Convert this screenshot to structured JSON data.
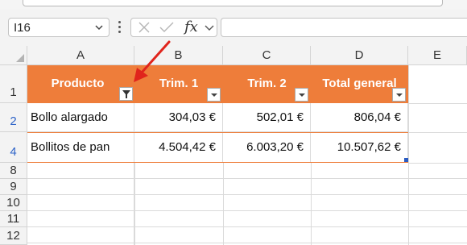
{
  "formula_bar": {
    "name_box": "I16",
    "fx": "fx"
  },
  "columns": [
    "A",
    "B",
    "C",
    "D",
    "E"
  ],
  "rows": [
    "1",
    "2",
    "4",
    "8",
    "9",
    "10",
    "11",
    "12"
  ],
  "table": {
    "headers": [
      "Producto",
      "Trim. 1",
      "Trim. 2",
      "Total general"
    ],
    "data": [
      [
        "Bollo alargado",
        "304,03 €",
        "502,01 €",
        "806,04 €"
      ],
      [
        "Bollitos de pan",
        "4.504,42 €",
        "6.003,20 €",
        "10.507,62 €"
      ]
    ]
  },
  "colors": {
    "header_fill": "#ee7d3a",
    "arrow": "#e0241c",
    "filtered_row_number": "#2f64c8"
  },
  "icons": {
    "cancel": "x-icon",
    "enter": "check-icon",
    "filter_active": "filter-icon",
    "dropdown": "chevron-down-icon",
    "annotation": "red-arrow"
  }
}
